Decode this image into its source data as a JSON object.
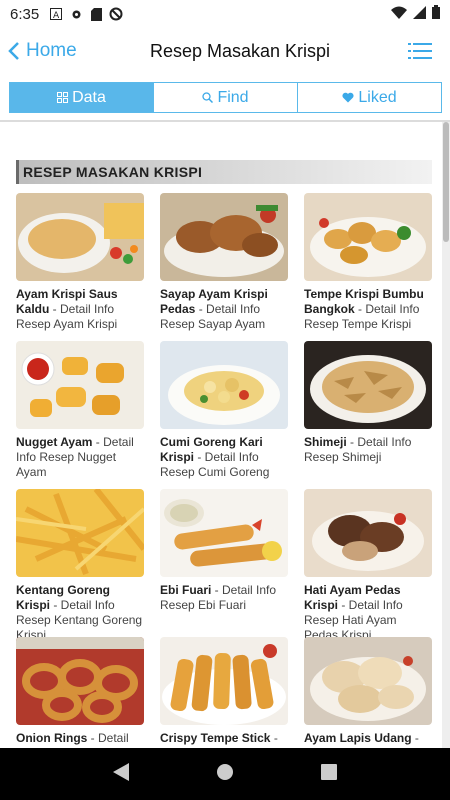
{
  "status": {
    "time": "6:35"
  },
  "header": {
    "back_label": "Home",
    "title": "Resep Masakan Krispi"
  },
  "tabs": [
    {
      "label": "Data",
      "active": true,
      "icon": "grid-icon"
    },
    {
      "label": "Find",
      "active": false,
      "icon": "search-icon"
    },
    {
      "label": "Liked",
      "active": false,
      "icon": "heart-icon"
    }
  ],
  "section": {
    "title": "RESEP MASAKAN KRISPI"
  },
  "recipes": [
    {
      "name": "Ayam Krispi Saus Kaldu",
      "desc": " - Detail Info Resep Ayam Krispi"
    },
    {
      "name": "Sayap Ayam Krispi Pedas",
      "desc": " - Detail Info Resep Sayap Ayam"
    },
    {
      "name": "Tempe Krispi Bumbu Bangkok",
      "desc": " - Detail Info Resep Tempe Krispi"
    },
    {
      "name": "Nugget Ayam",
      "desc": " - Detail Info Resep Nugget Ayam"
    },
    {
      "name": "Cumi Goreng Kari Krispi",
      "desc": " - Detail Info Resep Cumi Goreng"
    },
    {
      "name": "Shimeji",
      "desc": " - Detail Info Resep Shimeji"
    },
    {
      "name": "Kentang Goreng Krispi",
      "desc": " - Detail Info Resep Kentang Goreng Krispi"
    },
    {
      "name": "Ebi Fuari",
      "desc": " - Detail Info Resep Ebi Fuari"
    },
    {
      "name": "Hati Ayam Pedas Krispi",
      "desc": " - Detail Info Resep Hati Ayam Pedas Krispi"
    },
    {
      "name": "Onion Rings",
      "desc": " - Detail Info Resep Onion Rings"
    },
    {
      "name": "Crispy Tempe Stick",
      "desc": " - Detail Info Resep Crispy Tempe Stick"
    },
    {
      "name": "Ayam Lapis Udang",
      "desc": " - Detail Info Resep Ayam Lapis Udang"
    }
  ],
  "colors": {
    "accent": "#3ba9e8",
    "tab_active": "#59b7ea"
  }
}
